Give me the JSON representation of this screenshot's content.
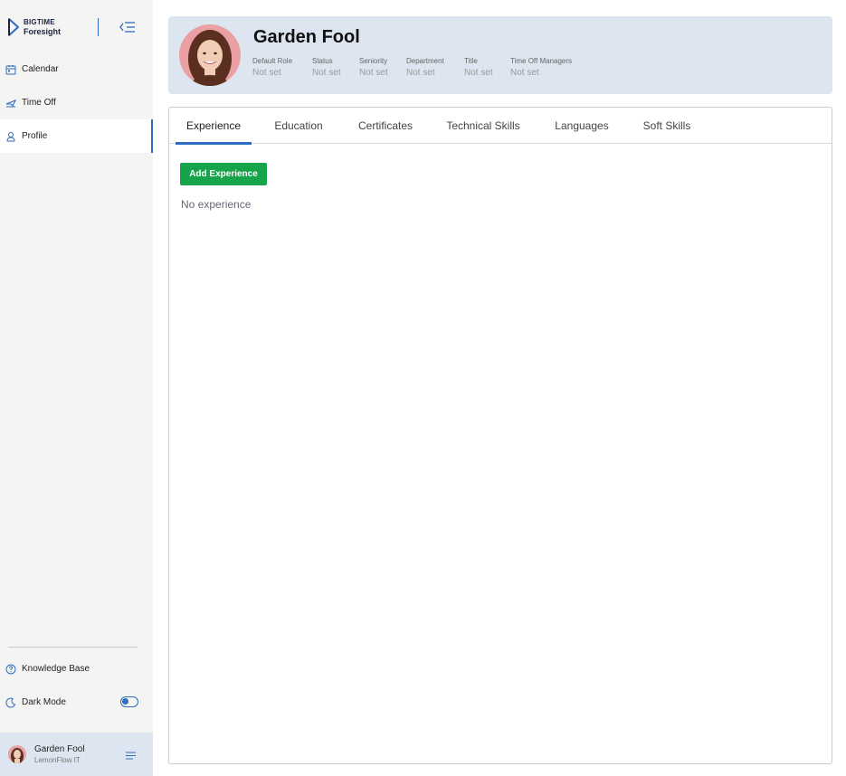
{
  "brand": {
    "line1": "BIGTIME",
    "line2": "Foresight"
  },
  "nav": {
    "items": [
      {
        "label": "Calendar",
        "icon": "calendar-icon"
      },
      {
        "label": "Time Off",
        "icon": "plane-icon"
      },
      {
        "label": "Profile",
        "icon": "user-icon",
        "active": true
      }
    ]
  },
  "bottom_nav": {
    "knowledge_base": "Knowledge Base",
    "dark_mode": "Dark Mode"
  },
  "user": {
    "name": "Garden Fool",
    "org": "LemonFlow IT"
  },
  "profile": {
    "name": "Garden Fool",
    "fields": [
      {
        "label": "Default Role",
        "value": "Not set"
      },
      {
        "label": "Status",
        "value": "Not set"
      },
      {
        "label": "Seniority",
        "value": "Not set"
      },
      {
        "label": "Department",
        "value": "Not set"
      },
      {
        "label": "Title",
        "value": "Not set"
      },
      {
        "label": "Time Off Managers",
        "value": "Not set"
      }
    ]
  },
  "tabs": [
    "Experience",
    "Education",
    "Certificates",
    "Technical Skills",
    "Languages",
    "Soft Skills"
  ],
  "active_tab": "Experience",
  "experience": {
    "add_label": "Add Experience",
    "empty_text": "No experience"
  },
  "colors": {
    "accent": "#2d6cc0",
    "add_button": "#16a34a",
    "header_bg": "#dde6f0",
    "sidebar_bg": "#f4f4f3"
  }
}
